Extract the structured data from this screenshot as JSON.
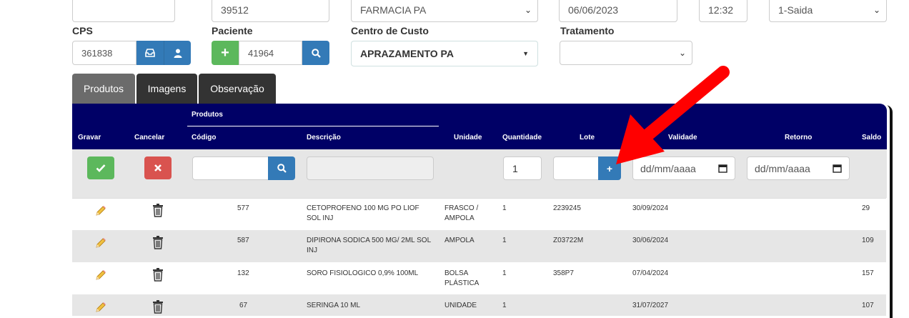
{
  "top_fields": {
    "field1_value": "",
    "field2_value": "39512",
    "farmacia_value": "FARMACIA PA",
    "date_value": "06/06/2023",
    "time_value": "12:32",
    "tipo_value": "1-Saida"
  },
  "labels": {
    "cps": "CPS",
    "paciente": "Paciente",
    "centro_custo": "Centro de Custo",
    "tratamento": "Tratamento"
  },
  "fields": {
    "cps_value": "361838",
    "paciente_value": "41964",
    "centro_custo_value": "APRAZAMENTO PA",
    "tratamento_value": ""
  },
  "tabs": [
    {
      "label": "Produtos"
    },
    {
      "label": "Imagens"
    },
    {
      "label": "Observação"
    }
  ],
  "table": {
    "group_header": "Produtos",
    "headers": {
      "gravar": "Gravar",
      "cancelar": "Cancelar",
      "codigo": "Código",
      "descricao": "Descrição",
      "unidade": "Unidade",
      "quantidade": "Quantidade",
      "lote": "Lote",
      "validade": "Validade",
      "retorno": "Retorno",
      "saldo": "Saldo"
    },
    "entry": {
      "quantidade_value": "1",
      "lote_plus": "+",
      "date_placeholder": "dd/mm/aaaa"
    },
    "rows": [
      {
        "codigo": "577",
        "descricao_l1": "CETOPROFENO 100 MG PO LIOF",
        "descricao_l2": "SOL INJ",
        "unidade_l1": "FRASCO /",
        "unidade_l2": "AMPOLA",
        "quantidade": "1",
        "lote": "2239245",
        "validade": "30/09/2024",
        "saldo": "29"
      },
      {
        "codigo": "587",
        "descricao_l1": "DIPIRONA SODICA 500 MG/ 2ML SOL",
        "descricao_l2": "INJ",
        "unidade_l1": "AMPOLA",
        "unidade_l2": "",
        "quantidade": "1",
        "lote": "Z03722M",
        "validade": "30/06/2024",
        "saldo": "109"
      },
      {
        "codigo": "132",
        "descricao_l1": "SORO FISIOLOGICO 0,9% 100ML",
        "descricao_l2": "",
        "unidade_l1": "BOLSA",
        "unidade_l2": "PLÁSTICA",
        "quantidade": "1",
        "lote": "358P7",
        "validade": "07/04/2024",
        "saldo": "157"
      },
      {
        "codigo": "67",
        "descricao_l1": "SERINGA 10 ML",
        "descricao_l2": "",
        "unidade_l1": "UNIDADE",
        "unidade_l2": "",
        "quantidade": "1",
        "lote": "",
        "validade": "31/07/2027",
        "saldo": "107"
      }
    ]
  },
  "colors": {
    "header_navy": "#000066",
    "primary_blue": "#337ab7",
    "success_green": "#5cb85c",
    "danger_red": "#d9534f",
    "annotation_red": "#ff0000"
  }
}
